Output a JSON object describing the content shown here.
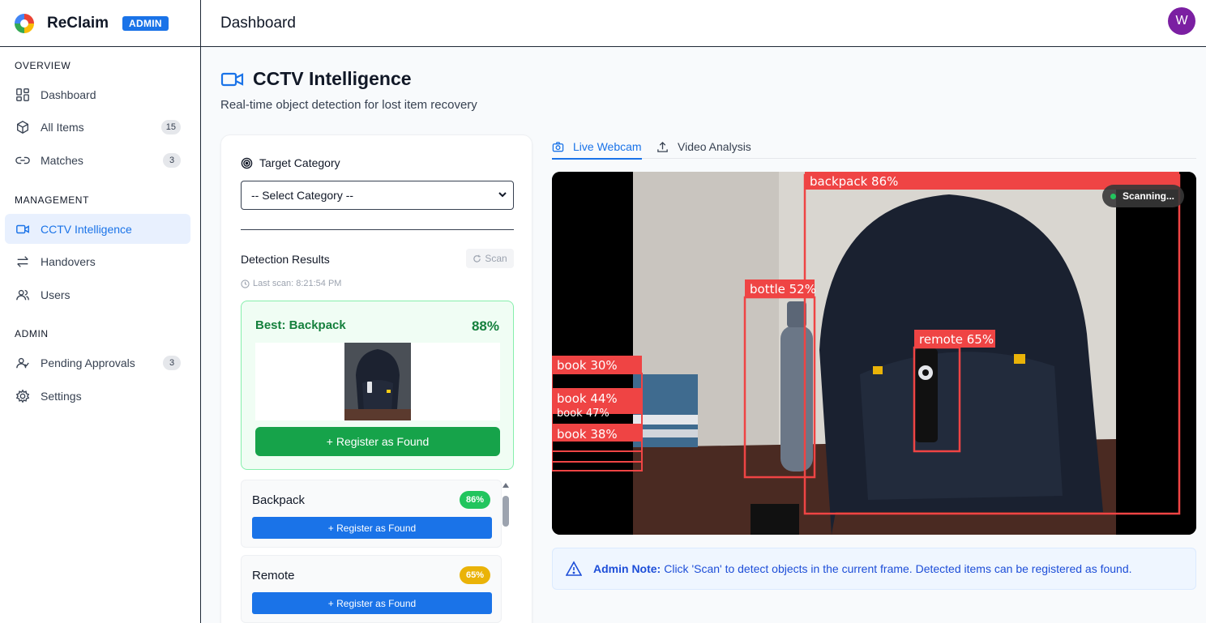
{
  "app": {
    "name": "ReClaim",
    "badge": "ADMIN"
  },
  "header": {
    "title": "Dashboard",
    "avatar_initial": "W",
    "avatar_color": "#7b1fa2"
  },
  "sidebar": {
    "sections": [
      {
        "label": "OVERVIEW"
      },
      {
        "label": "MANAGEMENT"
      },
      {
        "label": "ADMIN"
      }
    ],
    "items": [
      {
        "label": "Dashboard",
        "icon": "dashboard-icon"
      },
      {
        "label": "All Items",
        "icon": "box-icon",
        "count": "15"
      },
      {
        "label": "Matches",
        "icon": "link-icon",
        "count": "3"
      },
      {
        "label": "CCTV Intelligence",
        "icon": "video-icon",
        "active": true
      },
      {
        "label": "Handovers",
        "icon": "swap-icon"
      },
      {
        "label": "Users",
        "icon": "users-icon"
      },
      {
        "label": "Pending Approvals",
        "icon": "user-check-icon",
        "count": "3"
      },
      {
        "label": "Settings",
        "icon": "gear-icon"
      }
    ]
  },
  "page": {
    "title": "CCTV Intelligence",
    "subtitle": "Real-time object detection for lost item recovery"
  },
  "panel": {
    "target_label": "Target Category",
    "select_value": "-- Select Category --",
    "detection_title": "Detection Results",
    "scan_label": "Scan",
    "last_scan": "Last scan: 8:21:54 PM",
    "best": {
      "title": "Best: Backpack",
      "confidence": "88%",
      "button": "+ Register as Found"
    },
    "detections": [
      {
        "name": "Backpack",
        "confidence": "86%",
        "pill_color": "#22c55e",
        "button": "+ Register as Found"
      },
      {
        "name": "Remote",
        "confidence": "65%",
        "pill_color": "#eab308",
        "button": "+ Register as Found"
      }
    ]
  },
  "tabs": [
    {
      "label": "Live Webcam",
      "icon": "camera-icon",
      "active": true
    },
    {
      "label": "Video Analysis",
      "icon": "upload-icon",
      "active": false
    }
  ],
  "camera": {
    "status": "Scanning...",
    "boxes": [
      {
        "label": "backpack 86%"
      },
      {
        "label": "bottle 52%"
      },
      {
        "label": "remote 65%"
      },
      {
        "label": "book 30%"
      },
      {
        "label": "book 44%"
      },
      {
        "label": "book 47%"
      },
      {
        "label": "book 38%"
      }
    ],
    "box_color": "#ef4444"
  },
  "note": {
    "prefix": "Admin Note:",
    "text": "Click 'Scan' to detect objects in the current frame. Detected items can be registered as found."
  }
}
